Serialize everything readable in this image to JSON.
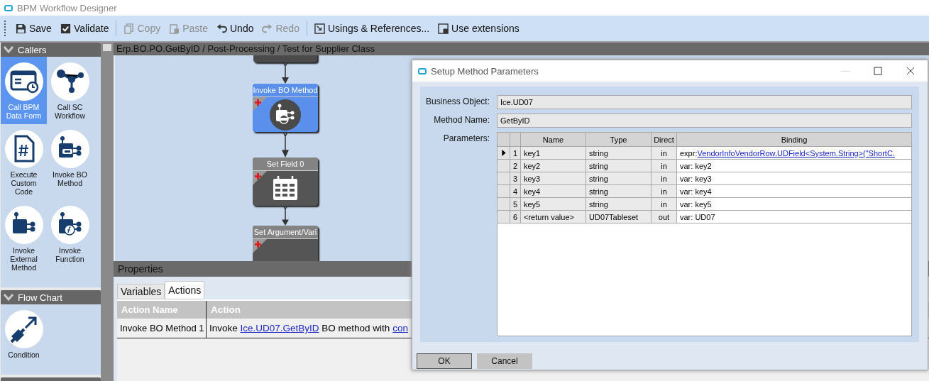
{
  "window": {
    "title": "BPM Workflow Designer"
  },
  "toolbar": [
    [
      {
        "label": "Save",
        "kind": "save",
        "disabled": false
      },
      {
        "label": "Validate",
        "kind": "validate",
        "disabled": false
      }
    ],
    [
      {
        "label": "Copy",
        "kind": "copy",
        "disabled": true
      },
      {
        "label": "Paste",
        "kind": "paste",
        "disabled": true
      },
      {
        "label": "Undo",
        "kind": "undo",
        "disabled": false
      },
      {
        "label": "Redo",
        "kind": "redo",
        "disabled": true
      }
    ],
    [
      {
        "label": "Usings & References...",
        "kind": "references",
        "disabled": false
      },
      {
        "label": "Use extensions",
        "kind": "extensions",
        "disabled": false
      }
    ]
  ],
  "sidebar": {
    "sections": [
      {
        "title": "Callers",
        "items": [
          {
            "label": "Call BPM Data Form",
            "kind": "form",
            "selected": true
          },
          {
            "label": "Call SC Workflow",
            "kind": "workflow",
            "selected": false
          },
          {
            "label": "Execute Custom Code",
            "kind": "code",
            "selected": false
          },
          {
            "label": "Invoke BO Method",
            "kind": "bo-method",
            "selected": false
          },
          {
            "label": "Invoke External Method",
            "kind": "external",
            "selected": false
          },
          {
            "label": "Invoke Function",
            "kind": "function",
            "selected": false
          }
        ]
      },
      {
        "title": "Flow Chart",
        "items": [
          {
            "label": "Condition",
            "kind": "condition",
            "selected": false
          }
        ]
      }
    ]
  },
  "designer": {
    "breadcrumb": "Erp.BO.PO.GetByID / Post-Processing / Test for Supplier Class",
    "nodes": [
      {
        "kind": "stub"
      },
      {
        "kind": "invoke-bo",
        "title": "Invoke BO Method",
        "selected": true
      },
      {
        "kind": "set-field",
        "title": "Set Field 0",
        "selected": false
      },
      {
        "kind": "set-argument",
        "title": "Set Argument/Vari",
        "selected": false
      }
    ]
  },
  "properties": {
    "title": "Properties",
    "tabs": [
      {
        "label": "Variables",
        "selected": false
      },
      {
        "label": "Actions",
        "selected": true
      }
    ],
    "columns": [
      "Action Name",
      "Action"
    ],
    "rows": [
      {
        "action_name": "Invoke BO Method 1",
        "action": [
          {
            "text": "Invoke ",
            "link": false
          },
          {
            "text": "Ice.UD07.GetByID",
            "link": true
          },
          {
            "text": " BO method with ",
            "link": false
          },
          {
            "text": "con",
            "link": true
          }
        ]
      }
    ]
  },
  "dialog": {
    "title": "Setup Method Parameters",
    "fields": [
      {
        "label": "Business Object:",
        "value": "Ice.UD07"
      },
      {
        "label": "Method Name:",
        "value": "GetByID"
      }
    ],
    "parameters_label": "Parameters:",
    "columns": [
      "Name",
      "Type",
      "Direct",
      "Binding"
    ],
    "rows": [
      {
        "num": "1",
        "name": "key1",
        "type": "string",
        "direction": "in",
        "current": true,
        "binding": [
          {
            "text": "expr:",
            "link": false
          },
          {
            "text": "VendorInfoVendorRow.UDField<System.String>(\"ShortC.",
            "link": true
          }
        ]
      },
      {
        "num": "2",
        "name": "key2",
        "type": "string",
        "direction": "in",
        "current": false,
        "binding": [
          {
            "text": "var: key2",
            "link": false
          }
        ]
      },
      {
        "num": "3",
        "name": "key3",
        "type": "string",
        "direction": "in",
        "current": false,
        "binding": [
          {
            "text": "var: key3",
            "link": false
          }
        ]
      },
      {
        "num": "4",
        "name": "key4",
        "type": "string",
        "direction": "in",
        "current": false,
        "binding": [
          {
            "text": "var: key4",
            "link": false
          }
        ]
      },
      {
        "num": "5",
        "name": "key5",
        "type": "string",
        "direction": "in",
        "current": false,
        "binding": [
          {
            "text": "var: key5",
            "link": false
          }
        ]
      },
      {
        "num": "6",
        "name": "<return value>",
        "type": "UD07Tableset",
        "direction": "out",
        "current": false,
        "binding": [
          {
            "text": "var: UD07",
            "link": false
          }
        ]
      }
    ],
    "buttons": [
      {
        "label": "OK",
        "default": true
      },
      {
        "label": "Cancel",
        "default": false
      }
    ]
  }
}
